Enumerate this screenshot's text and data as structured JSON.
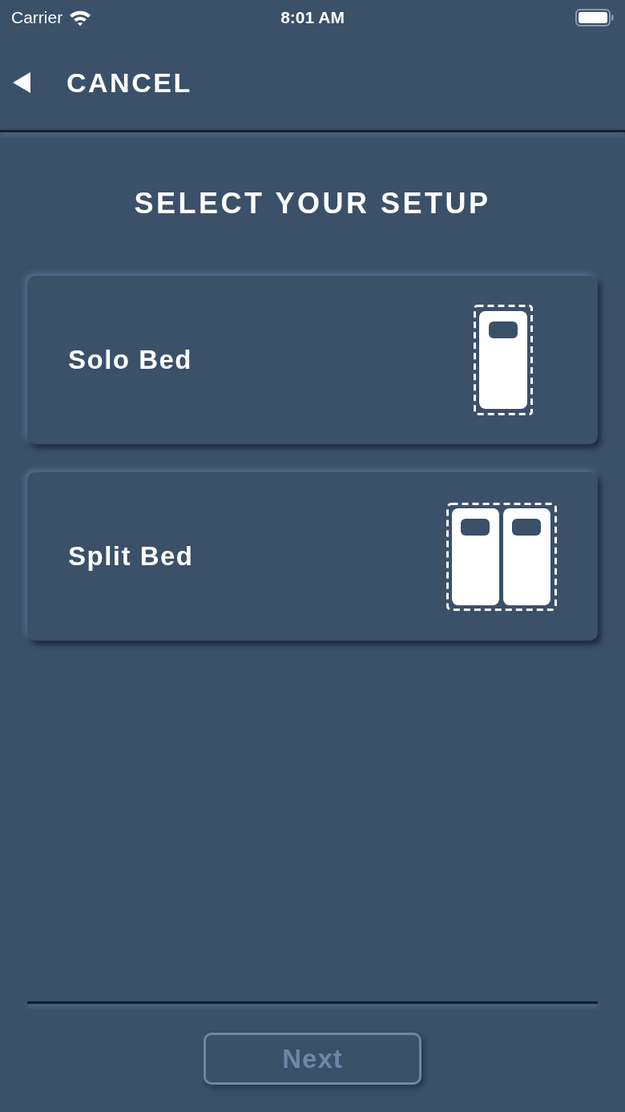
{
  "status_bar": {
    "carrier": "Carrier",
    "time": "8:01 AM"
  },
  "nav": {
    "back_label": "CANCEL"
  },
  "title": "SELECT YOUR SETUP",
  "options": [
    {
      "label": "Solo Bed",
      "kind": "solo",
      "selected": false
    },
    {
      "label": "Split Bed",
      "kind": "split",
      "selected": false
    }
  ],
  "next_button": {
    "label": "Next",
    "disabled": true
  }
}
